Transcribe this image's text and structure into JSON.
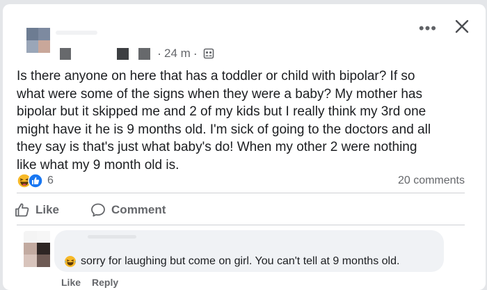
{
  "post": {
    "time": "24 m",
    "separator": "·",
    "text": "Is there anyone on here that has a toddler or child with bipolar? If so\nwhat were some of the signs when they were a baby? My mother has\nbipolar but it skipped me and 2 of my kids but I really think my 3rd one\nmight have it he is 9 months old. I'm sick of going to the doctors and all\nthey say is that's just what baby's do! When my other 2 were nothing\nlike what my 9 month old is.",
    "more_label": "•••"
  },
  "reactions": {
    "count": "6",
    "icons": [
      "haha-icon",
      "like-icon"
    ],
    "comments": "20 comments"
  },
  "actions": {
    "like": "Like",
    "comment": "Comment"
  },
  "comment": {
    "emoji": "laughing-with-tears-icon",
    "text": "sorry for laughing but come on girl. You can't tell at 9 months old.",
    "like": "Like",
    "reply": "Reply"
  },
  "colors": {
    "background": "#e4e6e9",
    "card": "#ffffff",
    "secondary_text": "#65676b",
    "like_blue": "#1877f2",
    "haha_yellow": "#f7b928",
    "bubble": "#f0f2f5"
  }
}
